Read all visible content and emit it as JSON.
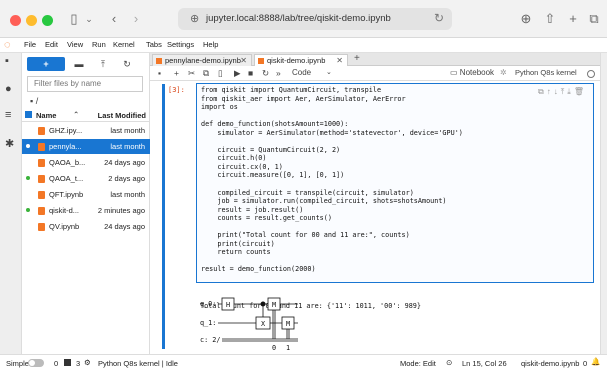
{
  "browser": {
    "url": "jupyter.local:8888/lab/tree/qiskit-demo.ipynb"
  },
  "menu": [
    "File",
    "Edit",
    "View",
    "Run",
    "Kernel",
    "Tabs",
    "Settings",
    "Help"
  ],
  "filebrowser": {
    "new_label": "+",
    "filter_placeholder": "Filter files by name",
    "breadcrumb": "/",
    "col_name": "Name",
    "col_modified": "Last Modified",
    "files": [
      {
        "name": "GHZ.ipy...",
        "modified": "last month",
        "dot": "",
        "selected": false
      },
      {
        "name": "pennyla...",
        "modified": "last month",
        "dot": "#3bb33b",
        "selected": true
      },
      {
        "name": "QAOA_b...",
        "modified": "24 days ago",
        "dot": "",
        "selected": false
      },
      {
        "name": "QAOA_t...",
        "modified": "2 days ago",
        "dot": "#3bb33b",
        "selected": false
      },
      {
        "name": "QFT.ipynb",
        "modified": "last month",
        "dot": "",
        "selected": false
      },
      {
        "name": "qiskit-d...",
        "modified": "2 minutes ago",
        "dot": "#3bb33b",
        "selected": false
      },
      {
        "name": "QV.ipynb",
        "modified": "24 days ago",
        "dot": "",
        "selected": false
      }
    ]
  },
  "tabs": [
    {
      "label": "pennylane-demo.ipynb",
      "active": false
    },
    {
      "label": "qiskit-demo.ipynb",
      "active": true
    }
  ],
  "toolbar": {
    "cell_type": "Code",
    "notebook_label": "Notebook",
    "kernel_label": "Python Q8s kernel"
  },
  "cell": {
    "prompt": "[3]:",
    "code": "from qiskit import QuantumCircuit, transpile\nfrom qiskit_aer import Aer, AerSimulator, AerError\nimport os\n\ndef demo_function(shotsAmount=1000):\n    simulator = AerSimulator(method='statevector', device='GPU')\n\n    circuit = QuantumCircuit(2, 2)\n    circuit.h(0)\n    circuit.cx(0, 1)\n    circuit.measure([0, 1], [0, 1])\n\n    compiled_circuit = transpile(circuit, simulator)\n    job = simulator.run(compiled_circuit, shots=shotsAmount)\n    result = job.result()\n    counts = result.get_counts()\n\n    print(\"Total count for 00 and 11 are:\", counts)\n    print(circuit)\n    return counts\n\nresult = demo_function(2000)",
    "output_line": "Total count for 00 and 11 are: {'11': 1011, '00': 989}",
    "circuit_q0": "q_0:",
    "circuit_q1": "q_1:",
    "circuit_c": "c: 2/",
    "circuit_h": "H",
    "circuit_x": "X",
    "circuit_m": "M",
    "circuit_bit0": "0",
    "circuit_bit1": "1"
  },
  "status": {
    "mode_label": "Simple",
    "count0": "0",
    "count1": "3",
    "kernel": "Python Q8s kernel | Idle",
    "mode": "Mode: Edit",
    "position": "Ln 15, Col 26",
    "file": "qiskit-demo.ipynb",
    "notif": "0"
  }
}
